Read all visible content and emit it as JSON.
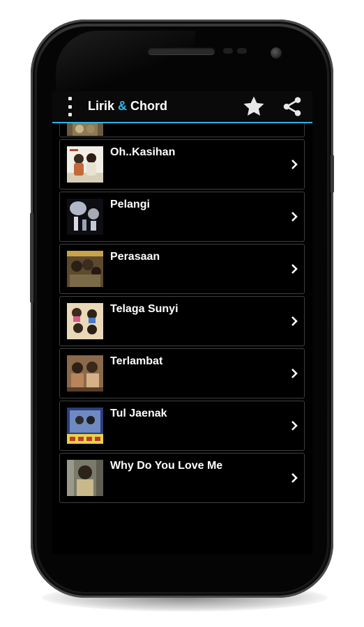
{
  "app": {
    "title_part1": "Lirik ",
    "title_amp": "&",
    "title_part2": " Chord"
  },
  "colors": {
    "accent": "#33b5e5",
    "background": "#000000",
    "text": "#ffffff"
  },
  "actions": {
    "menu_icon": "overflow-menu-icon",
    "favorite_icon": "star-icon",
    "share_icon": "share-icon"
  },
  "songs": [
    {
      "title": "Oh..Kasihan"
    },
    {
      "title": "Pelangi"
    },
    {
      "title": "Perasaan"
    },
    {
      "title": "Telaga Sunyi"
    },
    {
      "title": "Terlambat"
    },
    {
      "title": "Tul Jaenak"
    },
    {
      "title": "Why Do You Love Me"
    }
  ]
}
